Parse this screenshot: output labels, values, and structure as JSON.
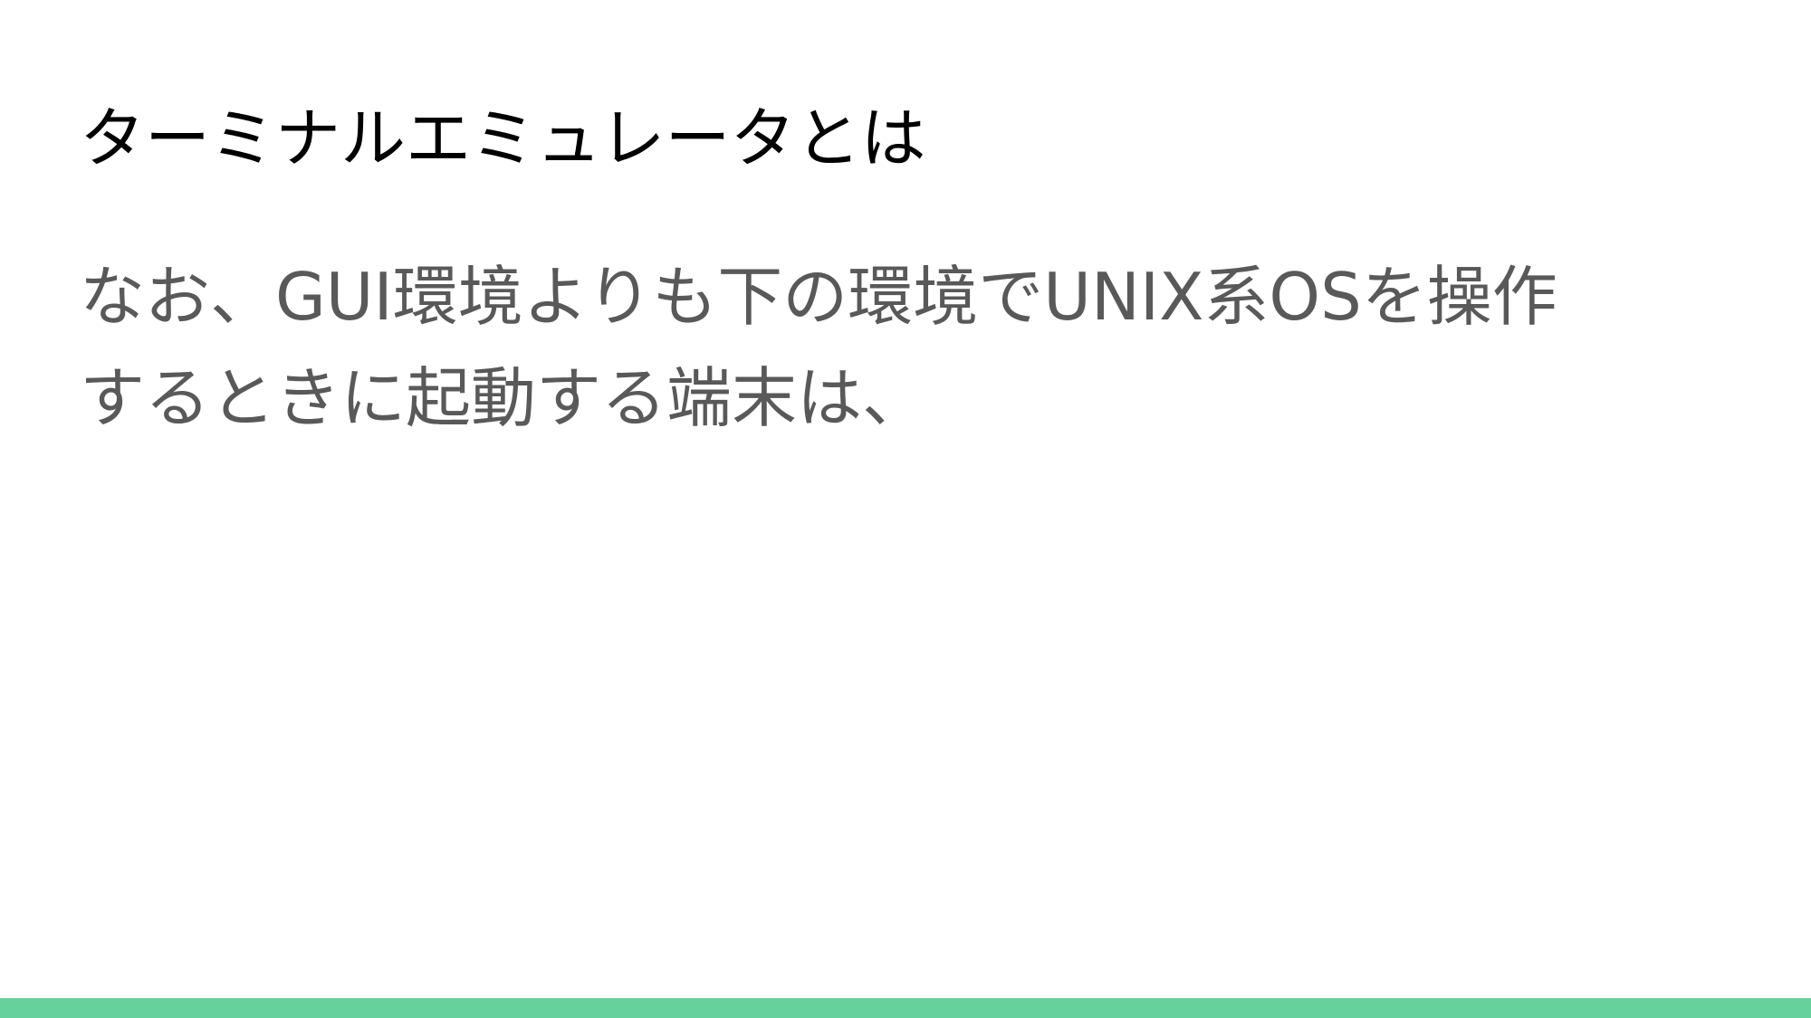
{
  "slide": {
    "title": "ターミナルエミュレータとは",
    "body_line_1": "なお、GUI環境よりも下の環境でUNIX系OSを操作",
    "body_line_2": "するときに起動する端末は、",
    "accent_color": "#66d19c",
    "title_color": "#000000",
    "body_color": "#595959"
  }
}
